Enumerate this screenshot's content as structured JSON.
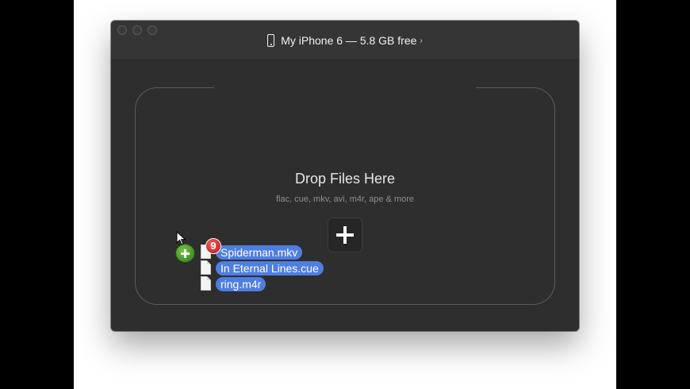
{
  "window": {
    "title": "My iPhone 6 — 5.8 GB free",
    "title_chevron": "›"
  },
  "dropzone": {
    "title": "Drop Files Here",
    "subtitle": "flac, cue, mkv, avi, m4r, ape & more",
    "add_icon": "plus-icon"
  },
  "drag": {
    "count": "9",
    "files": [
      "Spiderman.mkv",
      "In Eternal Lines.cue",
      "ring.m4r"
    ]
  },
  "colors": {
    "window_bg": "#2e2e2e",
    "selection": "#4f7ee0",
    "badge_red": "#d32020",
    "copy_green": "#4fa52a"
  }
}
